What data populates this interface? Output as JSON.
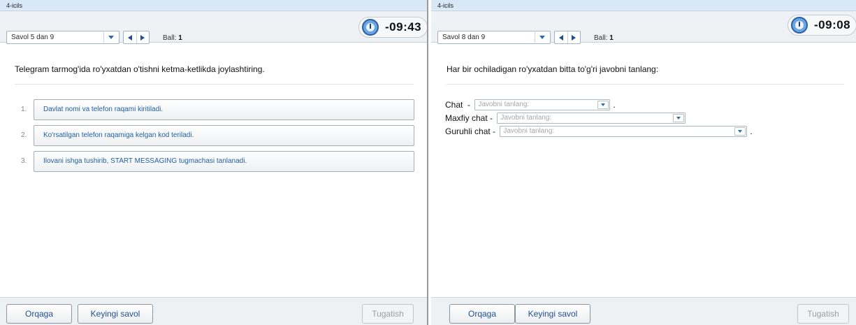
{
  "panels": [
    {
      "quiz_title": "4-icils",
      "question_select": "Savol 5 dan 9",
      "score_label": "Ball:",
      "score_value": "1",
      "timer": "-09:43",
      "question": "Telegram tarmog'ida ro'yxatdan o'tishni ketma-ketlikda joylashtiring.",
      "items": [
        {
          "num": "1.",
          "text": "Davlat nomi va telefon raqami kiritiladi."
        },
        {
          "num": "2.",
          "text": "Ko'rsatilgan telefon raqamiga kelgan kod teriladi."
        },
        {
          "num": "3.",
          "text": "Ilovani ishga tushirib, START MESSAGING tugmachasi tanlanadi."
        }
      ],
      "buttons": {
        "back": "Orqaga",
        "next": "Keyingi savol",
        "finish": "Tugatish"
      }
    },
    {
      "quiz_title": "4-icils",
      "question_select": "Savol 8 dan 9",
      "score_label": "Ball:",
      "score_value": "1",
      "timer": "-09:08",
      "question": "Har bir ochiladigan ro'yxatdan bitta to'g'ri javobni tanlang:",
      "matches": [
        {
          "label": "Chat  - ",
          "placeholder": "Javobni tanlang:",
          "suffix": "."
        },
        {
          "label": "Maxfiy chat - ",
          "placeholder": "Javobni tanlang:",
          "suffix": ""
        },
        {
          "label": "Guruhli chat - ",
          "placeholder": "Javobni tanlang:",
          "suffix": "."
        }
      ],
      "buttons": {
        "back": "Orqaga",
        "next": "Keyingi savol",
        "finish": "Tugatish"
      }
    }
  ],
  "colors": {
    "header_blue": "#d9e8f6",
    "link_blue": "#1f5fa3",
    "disabled_text": "#9b9ea2"
  }
}
